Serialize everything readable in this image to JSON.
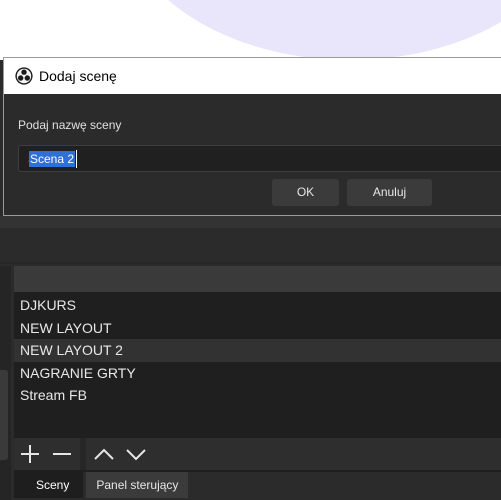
{
  "dialog": {
    "title": "Dodaj scenę",
    "prompt": "Podaj nazwę sceny",
    "input_value": "Scena 2",
    "ok_label": "OK",
    "cancel_label": "Anuluj"
  },
  "scenes": {
    "items": [
      {
        "label": "DJKURS"
      },
      {
        "label": "NEW LAYOUT"
      },
      {
        "label": "NEW LAYOUT 2"
      },
      {
        "label": "NAGRANIE GRTY"
      },
      {
        "label": "Stream FB"
      }
    ],
    "toolbar_icons": [
      "plus-icon",
      "minus-icon",
      "chevron-up-icon",
      "chevron-down-icon"
    ]
  },
  "dock": {
    "tabs": [
      {
        "label": "Sceny"
      },
      {
        "label": "Panel sterujący"
      }
    ]
  },
  "colors": {
    "selection": "#2e6fd8",
    "panel_bg": "#1f1f1f",
    "window_bg": "#2b2b2b"
  }
}
